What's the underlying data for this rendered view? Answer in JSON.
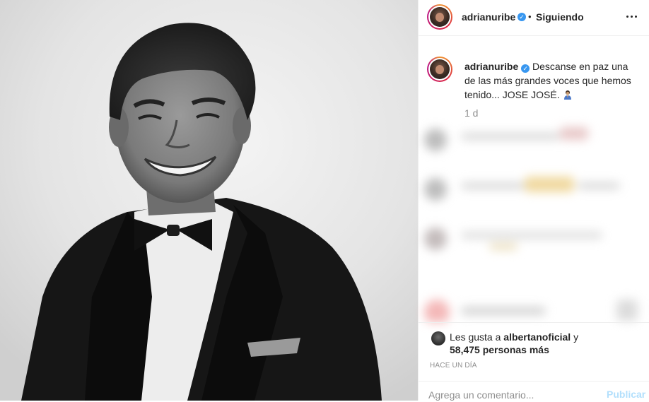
{
  "post": {
    "author": "adrianuribe",
    "follow_separator": "•",
    "follow_status": "Siguiendo",
    "caption": "Descanse en paz una de las más grandes voces que hemos tenido... JOSE JOSÉ.",
    "caption_emoji": "praying-person-emoji",
    "time_ago": "1 d",
    "likes": {
      "prefix": "Les gusta a",
      "user": "albertanoficial",
      "suffix": "y",
      "others": "58,475 personas más"
    },
    "posted_ago": "HACE UN DÍA"
  },
  "comment_box": {
    "placeholder": "Agrega un comentario...",
    "publish_label": "Publicar"
  },
  "colors": {
    "verified": "#3897f0",
    "muted": "#8e8e8e",
    "publish_disabled": "#b2dffc",
    "border": "#efefef"
  }
}
